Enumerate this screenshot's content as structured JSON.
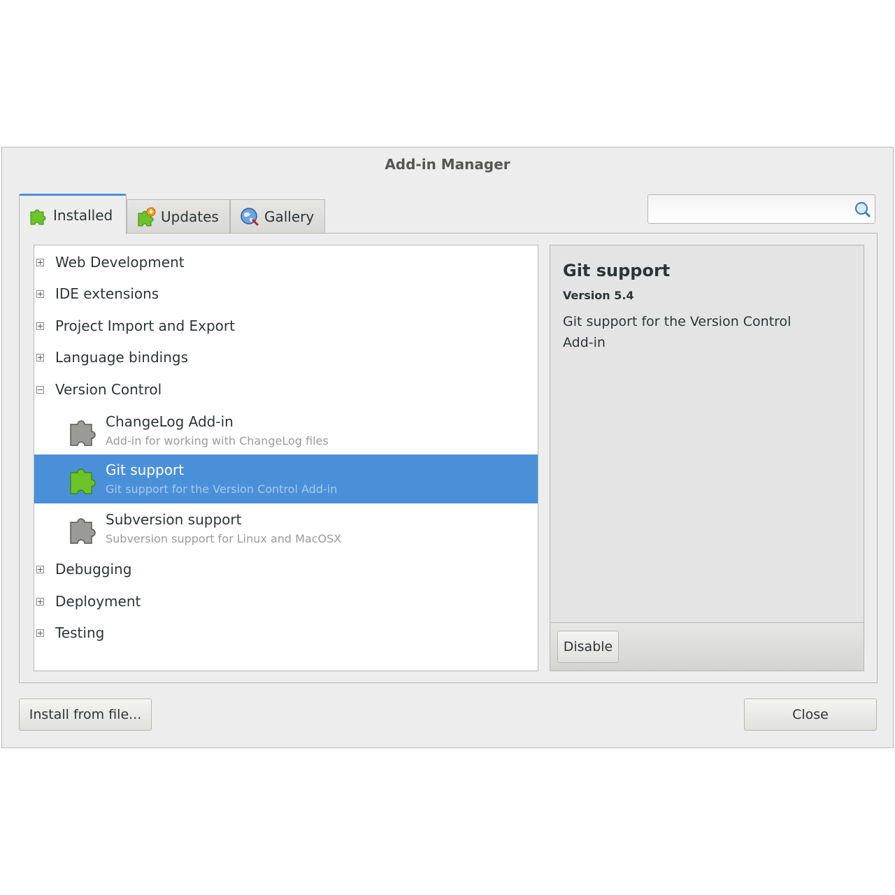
{
  "window": {
    "title": "Add-in Manager"
  },
  "tabs": [
    {
      "label": "Installed",
      "icon": "puzzle-green-icon",
      "active": true
    },
    {
      "label": "Updates",
      "icon": "puzzle-update-icon",
      "active": false
    },
    {
      "label": "Gallery",
      "icon": "globe-icon",
      "active": false
    }
  ],
  "search": {
    "value": "",
    "placeholder": "",
    "icon": "search-icon"
  },
  "tree": {
    "categories_before": [
      {
        "label": "Web Development",
        "expanded": false
      },
      {
        "label": "IDE extensions",
        "expanded": false
      },
      {
        "label": "Project Import and Export",
        "expanded": false
      },
      {
        "label": "Language bindings",
        "expanded": false
      }
    ],
    "expanded_category": {
      "label": "Version Control",
      "expanded": true
    },
    "addins": [
      {
        "name": "ChangeLog Add-in",
        "description": "Add-in for working with ChangeLog files",
        "enabled": false,
        "selected": false
      },
      {
        "name": "Git support",
        "description": "Git support for the Version Control Add-in",
        "enabled": true,
        "selected": true
      },
      {
        "name": "Subversion support",
        "description": "Subversion support for Linux and MacOSX",
        "enabled": false,
        "selected": false
      }
    ],
    "categories_after": [
      {
        "label": "Debugging",
        "expanded": false
      },
      {
        "label": "Deployment",
        "expanded": false
      },
      {
        "label": "Testing",
        "expanded": false
      }
    ]
  },
  "detail": {
    "title": "Git support",
    "version": "Version 5.4",
    "description": "Git support for the Version Control Add-in",
    "disable_label": "Disable"
  },
  "footer": {
    "install_label": "Install from file...",
    "close_label": "Close"
  },
  "colors": {
    "selection": "#4a90d9",
    "puzzle_enabled": "#6cc32a",
    "puzzle_disabled": "#8a8a88"
  }
}
